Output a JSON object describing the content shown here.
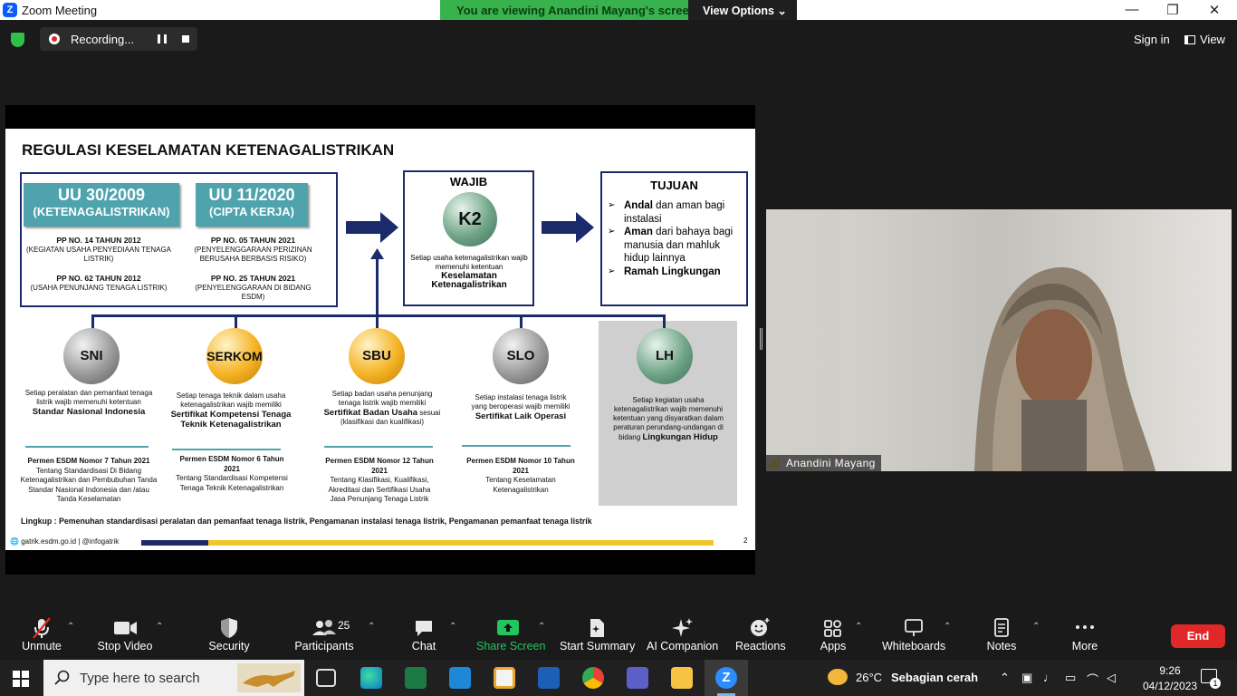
{
  "window": {
    "title": "Zoom Meeting",
    "minimize": "—",
    "restore": "❐",
    "close": "✕"
  },
  "banner": {
    "message": "You are viewing Anandini Mayang's screen",
    "view_options": "View Options ⌄"
  },
  "meeting_bar": {
    "recording": "Recording...",
    "sign_in": "Sign in",
    "view": "View"
  },
  "slide": {
    "title": "REGULASI KESELAMATAN KETENAGALISTRIKAN",
    "law1": {
      "name": "UU 30/2009",
      "sub": "(KETENAGALISTRIKAN)",
      "pp1_title": "PP NO. 14 TAHUN 2012",
      "pp1_desc": "(KEGIATAN USAHA PENYEDIAAN TENAGA LISTRIK)",
      "pp2_title": "PP NO. 62 TAHUN 2012",
      "pp2_desc": "(USAHA PENUNJANG TENAGA LISTRIK)"
    },
    "law2": {
      "name": "UU 11/2020",
      "sub": "(CIPTA KERJA)",
      "pp1_title": "PP NO. 05 TAHUN 2021",
      "pp1_desc": "(PENYELENGGARAAN PERIZINAN BERUSAHA BERBASIS RISIKO)",
      "pp2_title": "PP NO. 25 TAHUN 2021",
      "pp2_desc": "(PENYELENGGARAAN DI BIDANG ESDM)"
    },
    "wajib": {
      "heading": "WAJIB",
      "ball": "K2",
      "desc": "Setiap usaha ketenagalistrikan wajib memenuhi ketentuan",
      "desc_bold": "Keselamatan Ketenagalistrikan"
    },
    "tujuan": {
      "heading": "TUJUAN",
      "items": [
        {
          "bold": "Andal",
          "rest": " dan aman bagi instalasi"
        },
        {
          "bold": "Aman",
          "rest": " dari bahaya bagi manusia dan mahluk hidup lainnya"
        },
        {
          "bold": "Ramah Lingkungan",
          "rest": ""
        }
      ]
    },
    "pillars": [
      {
        "ball": "SNI",
        "desc": "Setiap peralatan dan pemanfaat tenaga listrik wajib memenuhi ketentuan",
        "bold": "Standar Nasional Indonesia",
        "after": "",
        "reg_title": "Permen ESDM Nomor 7 Tahun 2021",
        "reg_desc": "Tentang Standardisasi Di Bidang Ketenagalistrikan dan Pembubuhan Tanda Standar Nasional Indonesia dan /atau Tanda Keselamatan"
      },
      {
        "ball": "SERKOM",
        "desc": "Setiap tenaga teknik dalam usaha ketenagalistrikan wajib memiliki",
        "bold": "Sertifikat Kompetensi Tenaga Teknik Ketenagalistrikan",
        "after": "",
        "reg_title": "Permen ESDM Nomor 6 Tahun 2021",
        "reg_desc": "Tentang Standardisasi Kompetensi Tenaga Teknik Ketenagalistrikan"
      },
      {
        "ball": "SBU",
        "desc": "Setiap badan usaha penunjang tenaga listrik wajib memiliki",
        "bold": "Sertifikat Badan Usaha",
        "after": " sesuai (klasifikasi dan kualifikasi)",
        "reg_title": "Permen ESDM Nomor 12 Tahun 2021",
        "reg_desc": "Tentang Klasifikasi, Kualifikasi, Akreditasi dan Sertifikasi Usaha Jasa Penunjang Tenaga Listrik"
      },
      {
        "ball": "SLO",
        "desc": "Setiap instalasi tenaga listrik yang beroperasi wajib memiliki",
        "bold": "Sertifikat Laik Operasi",
        "after": "",
        "reg_title": "Permen ESDM Nomor 10 Tahun 2021",
        "reg_desc": "Tentang Keselamatan Ketenagalistrikan"
      },
      {
        "ball": "LH",
        "desc": "Setiap kegiatan usaha ketenagalistrikan wajib memenuhi ketentuan yang disyaratkan dalam peraturan perundang-undangan di bidang",
        "bold": "Lingkungan Hidup",
        "after": "",
        "reg_title": "",
        "reg_desc": ""
      }
    ],
    "lingkup": "Lingkup : Pemenuhan standardisasi peralatan dan pemanfaat tenaga listrik,  Pengamanan instalasi tenaga listrik, Pengamanan pemanfaat tenaga listrik",
    "footer": "gatrik.esdm.go.id | @infogatrik",
    "page_number": "2"
  },
  "participant": {
    "name": "Anandini Mayang"
  },
  "toolbar": {
    "unmute": "Unmute",
    "stop_video": "Stop Video",
    "security": "Security",
    "participants": "Participants",
    "participants_count": "25",
    "chat": "Chat",
    "share_screen": "Share Screen",
    "start_summary": "Start Summary",
    "ai_companion": "AI Companion",
    "reactions": "Reactions",
    "apps": "Apps",
    "whiteboards": "Whiteboards",
    "notes": "Notes",
    "more": "More",
    "end": "End"
  },
  "taskbar": {
    "search_placeholder": "Type here to search",
    "weather_temp": "26°C",
    "weather_desc": "Sebagian cerah",
    "time": "9:26",
    "date": "04/12/2023",
    "notification_count": "1"
  },
  "colors": {
    "zoom_blue": "#0b5cff",
    "banner_green": "#37b24d",
    "end_red": "#e02828",
    "slide_navy": "#1b2a6b",
    "slide_teal": "#4fa3ad"
  }
}
